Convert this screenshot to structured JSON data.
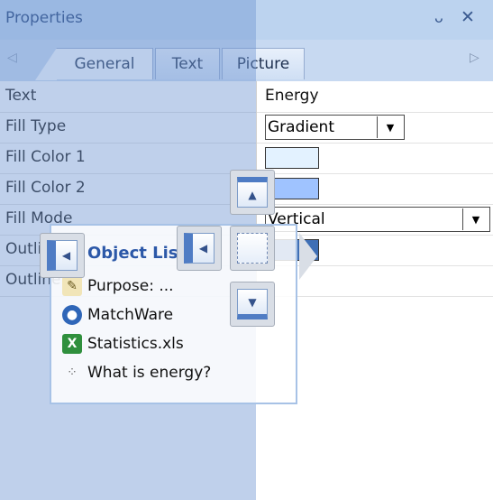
{
  "titlebar": {
    "title": "Properties",
    "pin_glyph": "ᴗ",
    "close_glyph": "✕"
  },
  "tabs": {
    "left_arrow": "◁",
    "right_arrow": "▷",
    "items": [
      "General",
      "Text",
      "Picture"
    ]
  },
  "grid": {
    "rows": [
      {
        "label": "Text",
        "value": "Energy"
      },
      {
        "label": "Fill Type",
        "value": "Gradient"
      },
      {
        "label": "Fill Color 1",
        "color": "#e3f2ff"
      },
      {
        "label": "Fill Color 2",
        "color": "#9fc3ff"
      },
      {
        "label": "Fill Mode",
        "value": "Vertical"
      },
      {
        "label": "Outline",
        "color": "#3f6fb5"
      },
      {
        "label": "Outline"
      }
    ],
    "dropdown_glyph": "▼"
  },
  "object_list": {
    "title": "Object List",
    "items": [
      {
        "label": "Purpose: ...",
        "icon": "pencil-doc-icon"
      },
      {
        "label": "MatchWare",
        "icon": "globe-person-icon"
      },
      {
        "label": "Statistics.xls",
        "icon": "excel-icon"
      },
      {
        "label": "What is energy?",
        "icon": "dotted-path-icon"
      }
    ]
  },
  "dock": {
    "arrow_left": "◀",
    "arrow_up": "▲",
    "arrow_down": "▼"
  },
  "colors": {
    "title_bg": "#bcd3ef",
    "overlay": "#7096d2",
    "accent": "#4f7cc4"
  }
}
